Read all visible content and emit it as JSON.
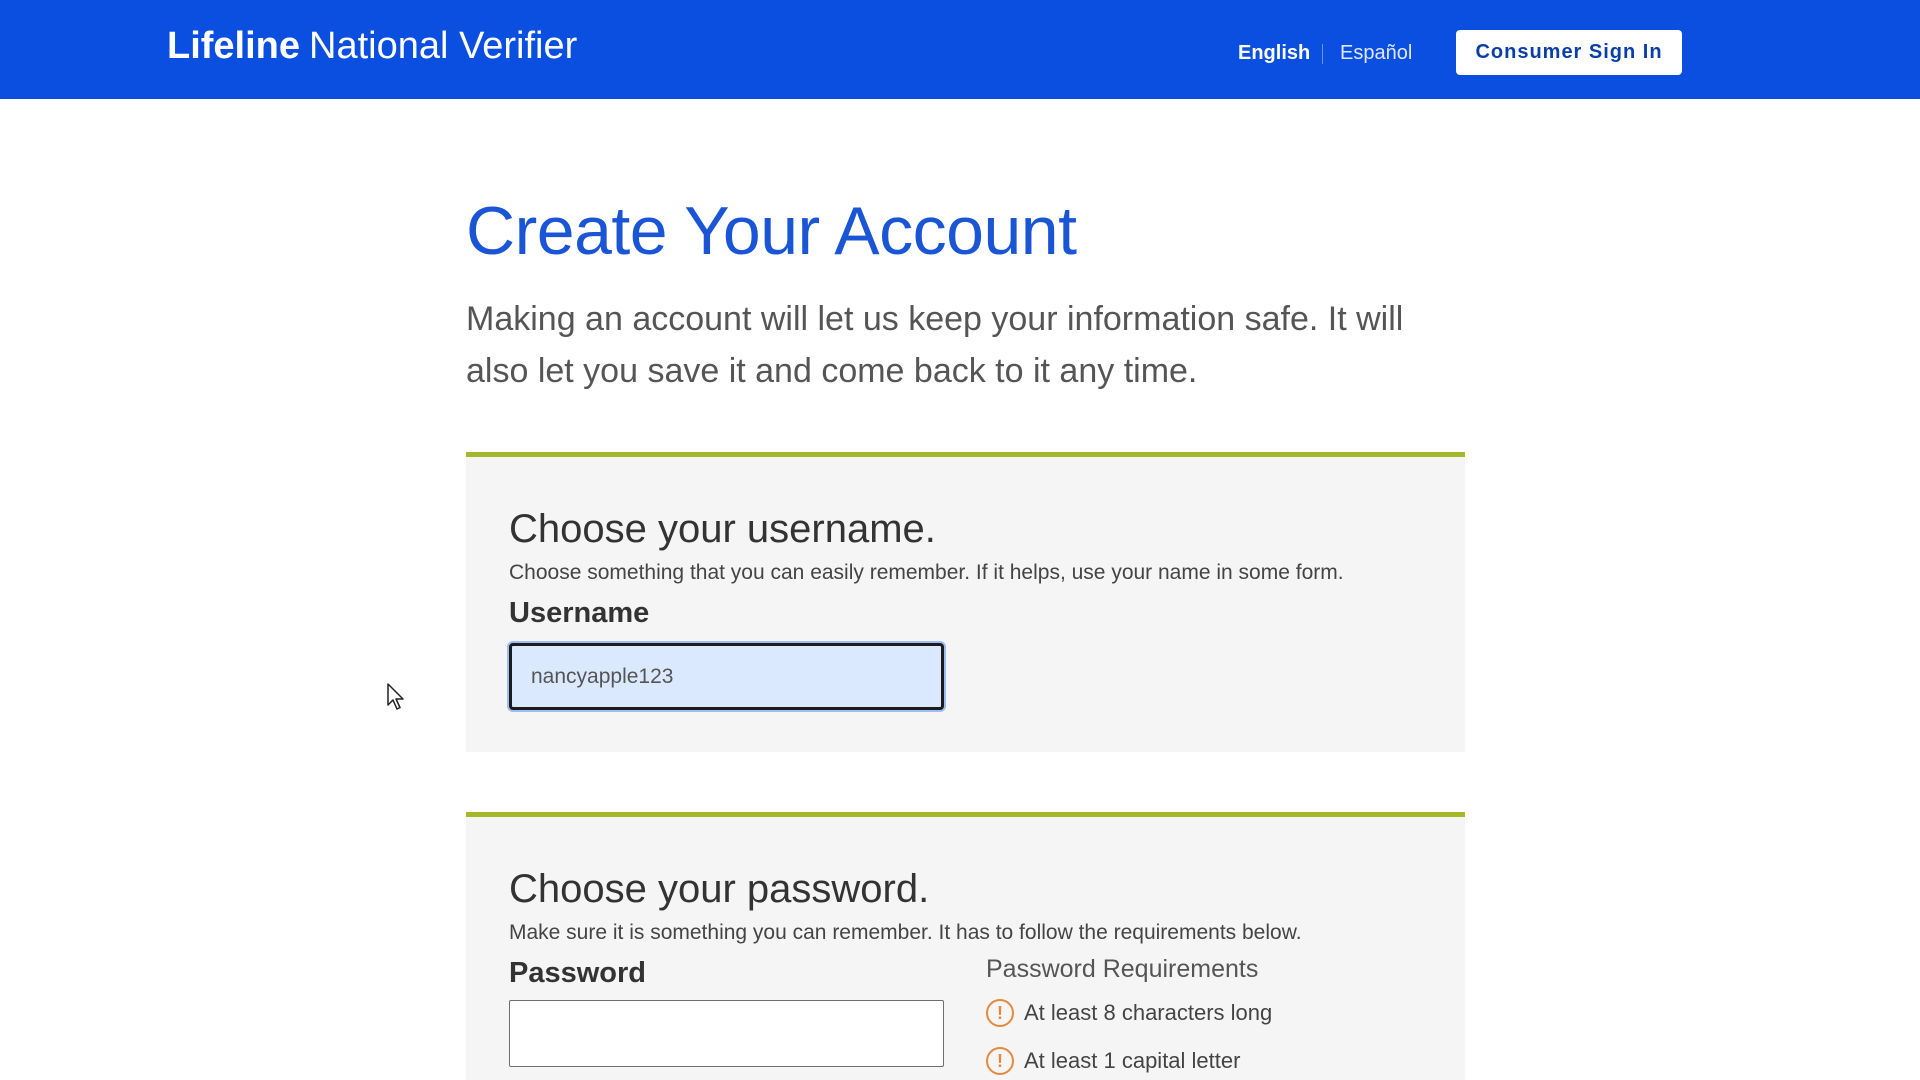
{
  "header": {
    "brand_bold": "Lifeline",
    "brand_rest": "National Verifier",
    "lang_english": "English",
    "lang_spanish": "Español",
    "signin_label": "Consumer Sign In",
    "background_color": "#0a4fe0"
  },
  "main": {
    "title": "Create Your Account",
    "intro": "Making an account will let us keep your information safe. It will also let you save it and come back to it any time.",
    "title_color": "#1a55d6",
    "card_accent_color": "#a4b82a"
  },
  "username_section": {
    "heading": "Choose your username.",
    "help": "Choose something that you can easily remember. If it helps, use your name in some form.",
    "label": "Username",
    "value": "nancyapple123"
  },
  "password_section": {
    "heading": "Choose your password.",
    "help": "Make sure it is something you can remember. It has to follow the requirements below.",
    "label": "Password",
    "value": "",
    "requirements_title": "Password Requirements",
    "requirements": [
      {
        "text": "At least 8 characters long",
        "icon": "warning-circle-icon"
      },
      {
        "text": "At least 1 capital letter",
        "icon": "warning-circle-icon"
      }
    ],
    "warning_color": "#e38a3b"
  },
  "icons": {
    "cursor": "mouse-pointer-icon",
    "warning": "!"
  }
}
